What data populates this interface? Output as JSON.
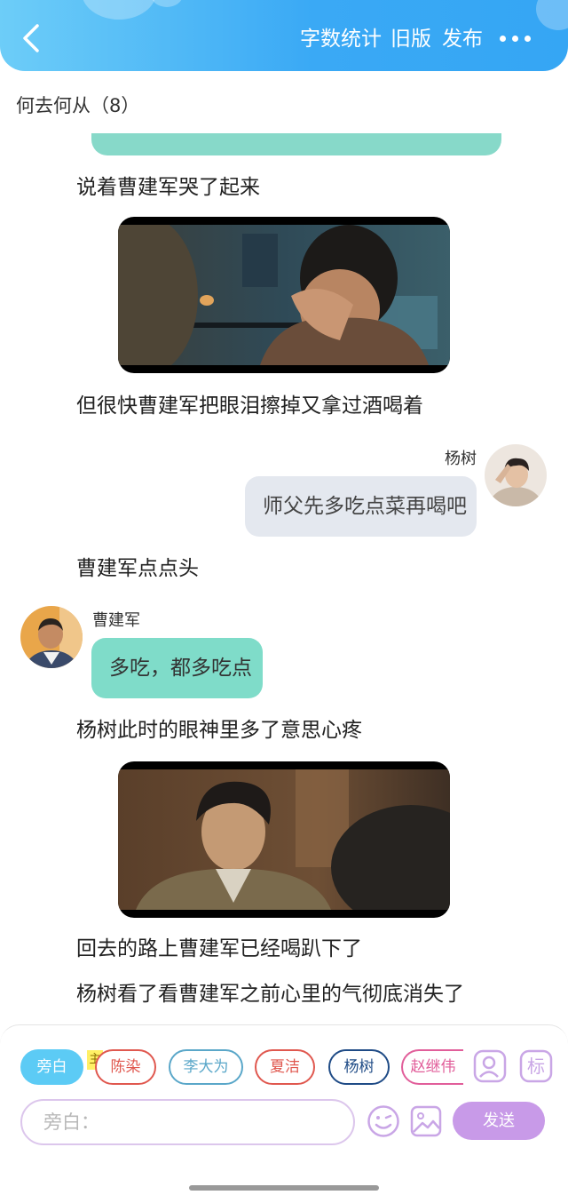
{
  "header": {
    "links": [
      "字数统计",
      "旧版",
      "发布"
    ],
    "accent_color": "#35a6f4",
    "back_icon": "chevron-left-icon",
    "more_icon": "more-dots-icon"
  },
  "story": {
    "title": "何去何从（8）"
  },
  "feed": {
    "narration_1": "说着曹建军哭了起来",
    "narration_2": "但很快曹建军把眼泪擦掉又拿过酒喝着",
    "message_yang_name": "杨树",
    "message_yang_text": "师父先多吃点菜再喝吧",
    "narration_3": "曹建军点点头",
    "message_cao_name": "曹建军",
    "message_cao_text": "多吃，都多吃点",
    "narration_4": "杨树此时的眼神里多了意思心疼",
    "narration_5": "回去的路上曹建军已经喝趴下了",
    "narration_6": "杨树看了看曹建军之前心里的气彻底消失了"
  },
  "composer": {
    "roles": [
      {
        "label": "旁白",
        "color": "#5ccbf5",
        "active": true
      },
      {
        "label": "陈染",
        "color": "#e0584f"
      },
      {
        "label": "李大为",
        "color": "#5aa7c9"
      },
      {
        "label": "夏洁",
        "color": "#e0584f"
      },
      {
        "label": "杨树",
        "color": "#1f4b86"
      },
      {
        "label": "赵继伟",
        "color": "#e15e9a"
      }
    ],
    "main_tag": "主",
    "mark_label": "标",
    "input_placeholder": "旁白：",
    "send_label": "发送",
    "send_color": "#c89ae8"
  }
}
